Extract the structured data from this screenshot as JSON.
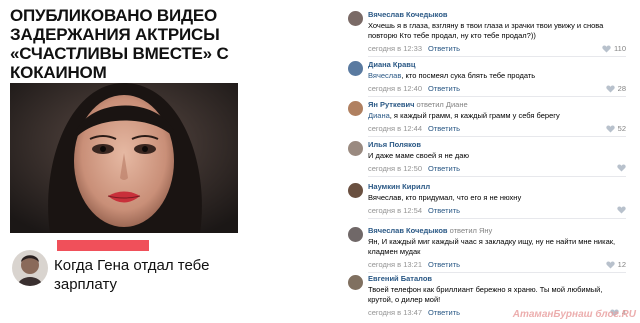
{
  "left": {
    "headline": "ОПУБЛИКОВАНО ВИДЕО ЗАДЕРЖАНИЯ АКТРИСЫ «СЧАСТЛИВЫ ВМЕСТЕ» С КОКАИНОМ",
    "meme_text": "Когда Гена отдал тебе зарплату"
  },
  "comments": [
    {
      "name": "Вячеслав Кочедыков",
      "reply_to": "",
      "text": "Хочешь я в глаза, взгляну в твои глаза и зрачки твои увижу и снова повторю Кто тебе продал, ну кто тебе продал?))",
      "time": "сегодня в 12:33",
      "action": "Ответить",
      "likes": "110"
    },
    {
      "name": "Диана Кравц",
      "reply_to": "",
      "mention": "Вячеслав",
      "text": ", кто посмеял сука блять тебе продать",
      "time": "сегодня в 12:40",
      "action": "Ответить",
      "likes": "28"
    },
    {
      "name": "Ян Руткевич",
      "reply_to": "ответил Диане",
      "mention": "Диана",
      "text": ", я каждый грамм, я каждый грамм у себя берегу",
      "time": "сегодня в 12:44",
      "action": "Ответить",
      "likes": "52"
    },
    {
      "name": "Илья Поляков",
      "reply_to": "",
      "mention": "",
      "text": "И даже маме своей я не даю",
      "time": "сегодня в 12:50",
      "action": "Ответить",
      "likes": ""
    },
    {
      "name": "Наумкин Кирилл",
      "reply_to": "",
      "mention": "",
      "text": "Вячеслав, кто придумал, что его я не нюхну",
      "time": "сегодня в 12:54",
      "action": "Ответить",
      "likes": ""
    },
    {
      "name": "Вячеслав Кочедыков",
      "reply_to": "ответил Яну",
      "mention": "",
      "text": "Ян, И каждый миг каждый чаас я закладку ищу, ну не найти мне никак, кладмен мудак",
      "time": "сегодня в 13:21",
      "action": "Ответить",
      "likes": "12"
    },
    {
      "name": "Евгений Баталов",
      "reply_to": "",
      "mention": "",
      "text": "Твоей телефон как бриллиант бережно я храню. Ты мой любимый, крутой, о дилер мой!",
      "time": "сегодня в 13:47",
      "action": "Ответить",
      "likes": "4"
    }
  ],
  "watermark": "АтаманБурнаш блог.RU",
  "colors": {
    "link": "#2a5885",
    "meta": "#939393",
    "red_bar": "#f0505a"
  }
}
